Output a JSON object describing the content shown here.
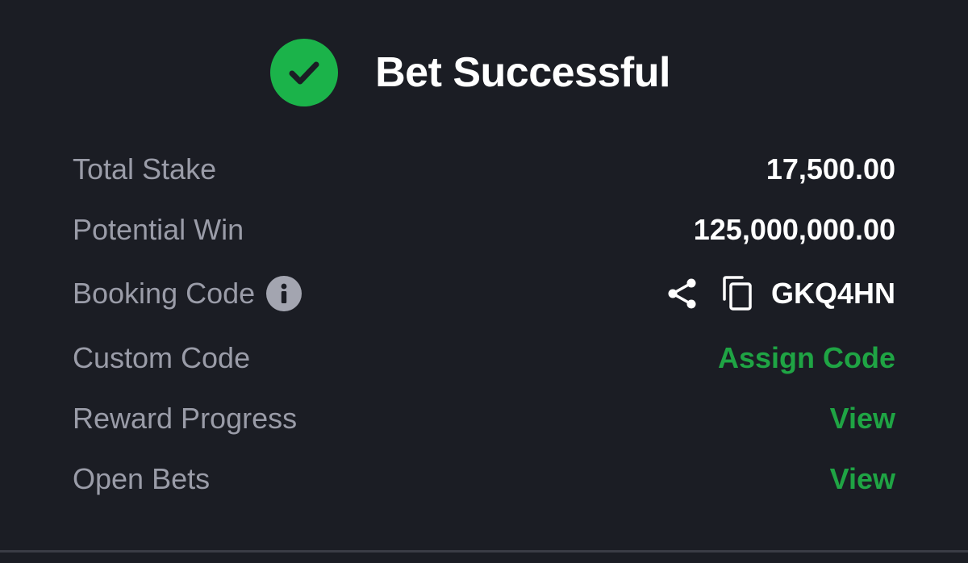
{
  "header": {
    "title": "Bet Successful",
    "icon": "check-circle-icon",
    "icon_color": "#1bb34a"
  },
  "details": {
    "total_stake": {
      "label": "Total Stake",
      "value": "17,500.00"
    },
    "potential_win": {
      "label": "Potential Win",
      "value": "125,000,000.00"
    },
    "booking_code": {
      "label": "Booking Code",
      "info_icon": "info-icon",
      "share_icon": "share-icon",
      "copy_icon": "copy-icon",
      "value": "GKQ4HN"
    },
    "custom_code": {
      "label": "Custom Code",
      "action": "Assign Code"
    },
    "reward_progress": {
      "label": "Reward Progress",
      "action": "View"
    },
    "open_bets": {
      "label": "Open Bets",
      "action": "View"
    }
  },
  "colors": {
    "background": "#1b1d24",
    "label": "#9a9ca8",
    "value": "#ffffff",
    "accent_green": "#1fa444"
  }
}
